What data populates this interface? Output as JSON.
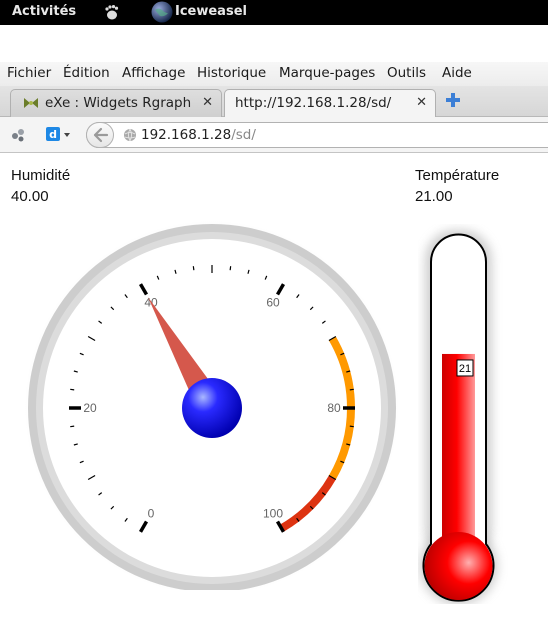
{
  "topbar": {
    "activities": "Activités",
    "app_name": "Iceweasel"
  },
  "menubar": {
    "items": [
      "Fichier",
      "Édition",
      "Affichage",
      "Historique",
      "Marque-pages",
      "Outils",
      "Aide"
    ]
  },
  "tabs": [
    {
      "label": "eXe : Widgets Rgraph",
      "active": false
    },
    {
      "label": "http://192.168.1.28/sd/",
      "active": true
    }
  ],
  "url": {
    "host": "192.168.1.28",
    "path": "/sd/"
  },
  "humidity": {
    "label": "Humidité",
    "value_text": "40.00",
    "value": 40,
    "min": 0,
    "max": 100,
    "tick_labels": [
      "0",
      "20",
      "40",
      "60",
      "80",
      "100"
    ],
    "orange_range": [
      70,
      90
    ],
    "red_range": [
      90,
      100
    ],
    "colors": {
      "orange": "#ff9900",
      "red": "#dd3311",
      "needle": "#d5584c",
      "hub": "#1a1aff"
    }
  },
  "temperature": {
    "label": "Température",
    "value_text": "21.00",
    "value": 21,
    "min": 0,
    "max": 50,
    "bubble_label": "21",
    "color": "#ff0000"
  }
}
